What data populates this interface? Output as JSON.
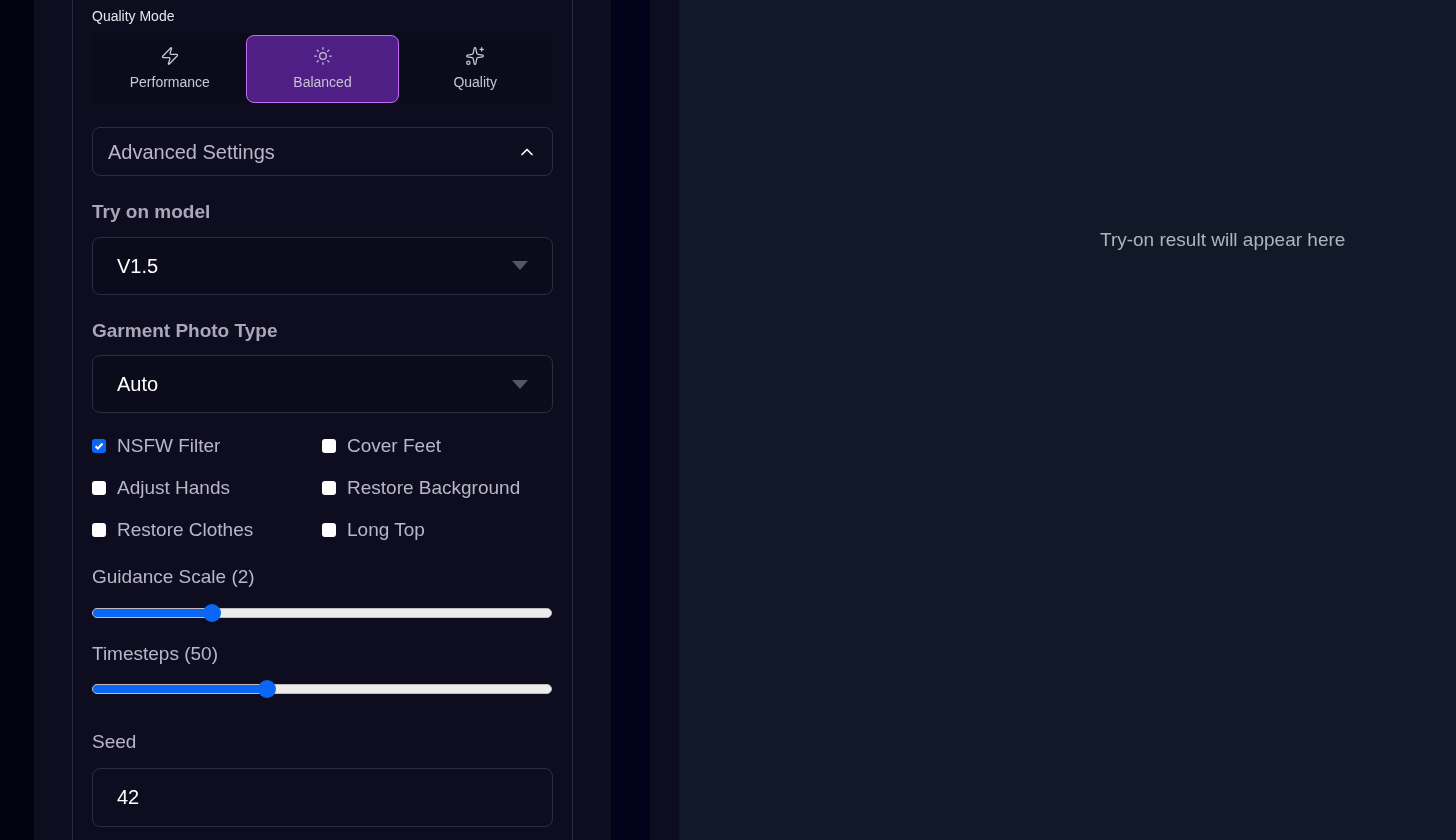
{
  "quality_mode": {
    "label": "Quality Mode",
    "options": [
      {
        "label": "Performance",
        "kind": "bolt",
        "selected": false
      },
      {
        "label": "Balanced",
        "kind": "sun",
        "selected": true
      },
      {
        "label": "Quality",
        "kind": "sparkles",
        "selected": false
      }
    ]
  },
  "advanced_settings": {
    "title": "Advanced Settings",
    "expanded": true
  },
  "selects": [
    {
      "label": "Try on model",
      "value": "V1.5"
    },
    {
      "label": "Garment Photo Type",
      "value": "Auto"
    }
  ],
  "checkboxes": [
    {
      "label": "NSFW Filter",
      "checked": true
    },
    {
      "label": "Cover Feet",
      "checked": false
    },
    {
      "label": "Adjust Hands",
      "checked": false
    },
    {
      "label": "Restore Background",
      "checked": false
    },
    {
      "label": "Restore Clothes",
      "checked": false
    },
    {
      "label": "Long Top",
      "checked": false
    }
  ],
  "sliders": [
    {
      "label": "Guidance Scale (2)",
      "level": 0.26
    },
    {
      "label": "Timesteps (50)",
      "level": 0.38
    }
  ],
  "seed": {
    "label": "Seed",
    "value": "42"
  },
  "result": {
    "placeholder": "Try-on result will appear here"
  }
}
